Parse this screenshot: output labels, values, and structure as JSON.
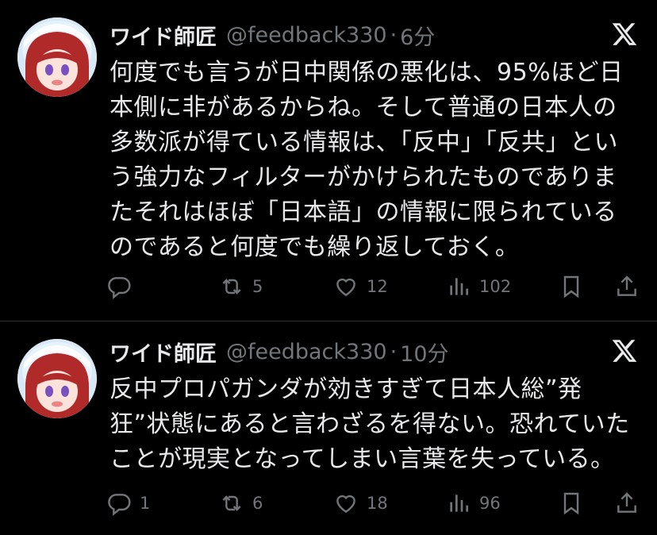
{
  "tweets": [
    {
      "display_name": "ワイド師匠",
      "handle": "@feedback330",
      "separator": "·",
      "time": "6分",
      "text": "何度でも言うが日中関係の悪化は、95%ほど日本側に非があるからね。そして普通の日本人の多数派が得ている情報は、「反中」「反共」という強力なフィルターがかけられたものでありまたそれはほぼ「日本語」の情報に限られているのであると何度でも繰り返しておく。",
      "replies": "",
      "retweets": "5",
      "likes": "12",
      "views": "102"
    },
    {
      "display_name": "ワイド師匠",
      "handle": "@feedback330",
      "separator": "·",
      "time": "10分",
      "text": "反中プロパガンダが効きすぎて日本人総”発狂”状態にあると言わざるを得ない。恐れていたことが現実となってしまい言葉を失っている。",
      "replies": "1",
      "retweets": "6",
      "likes": "18",
      "views": "96"
    }
  ],
  "icons": {
    "reply": "reply-icon",
    "retweet": "retweet-icon",
    "like": "heart-icon",
    "views": "views-icon",
    "bookmark": "bookmark-icon",
    "share": "share-icon",
    "brand": "x-logo-icon"
  },
  "colors": {
    "background": "#000000",
    "text": "#e7e9ea",
    "muted": "#71767b",
    "divider": "#2f3336"
  }
}
